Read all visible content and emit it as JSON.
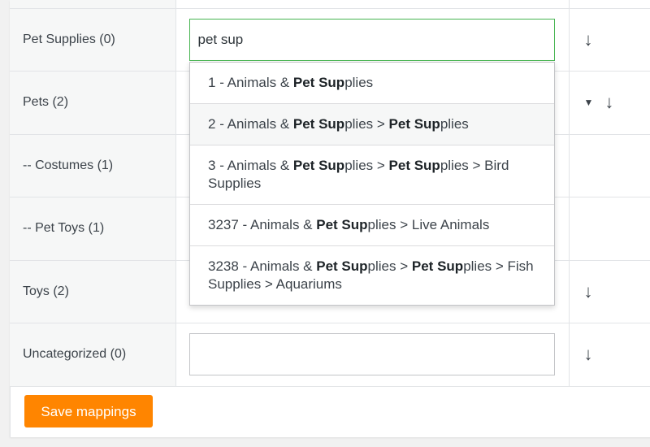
{
  "rows": [
    {
      "category": "Pet Supplies (0)",
      "input_value": "pet sup"
    },
    {
      "category": "Pets (2)"
    },
    {
      "category": "-- Costumes (1)"
    },
    {
      "category": "-- Pet Toys (1)"
    },
    {
      "category": "Toys (2)"
    },
    {
      "category": "Uncategorized (0)",
      "input_value": ""
    }
  ],
  "icons": {
    "arrow": "↓",
    "caret": "▼"
  },
  "dropdown": {
    "options": [
      {
        "id": "1",
        "sep": " - ",
        "parts": [
          "Animals & ",
          "Pet Sup",
          "plies"
        ]
      },
      {
        "id": "2",
        "sep": " - ",
        "parts": [
          "Animals & ",
          "Pet Sup",
          "plies > ",
          "Pet Sup",
          "plies"
        ]
      },
      {
        "id": "3",
        "sep": " - ",
        "parts": [
          "Animals & ",
          "Pet Sup",
          "plies > ",
          "Pet Sup",
          "plies > Bird Supplies"
        ]
      },
      {
        "id": "3237",
        "sep": " - ",
        "parts": [
          "Animals & ",
          "Pet Sup",
          "plies > Live Animals"
        ]
      },
      {
        "id": "3238",
        "sep": " - ",
        "parts": [
          "Animals & ",
          "Pet Sup",
          "plies > ",
          "Pet Sup",
          "plies > Fish Supplies > Aquariums"
        ]
      }
    ],
    "highlighted_index": 1
  },
  "save_button": {
    "label": "Save mappings"
  },
  "colors": {
    "accent": "#ff8500",
    "focus": "#46b450"
  }
}
